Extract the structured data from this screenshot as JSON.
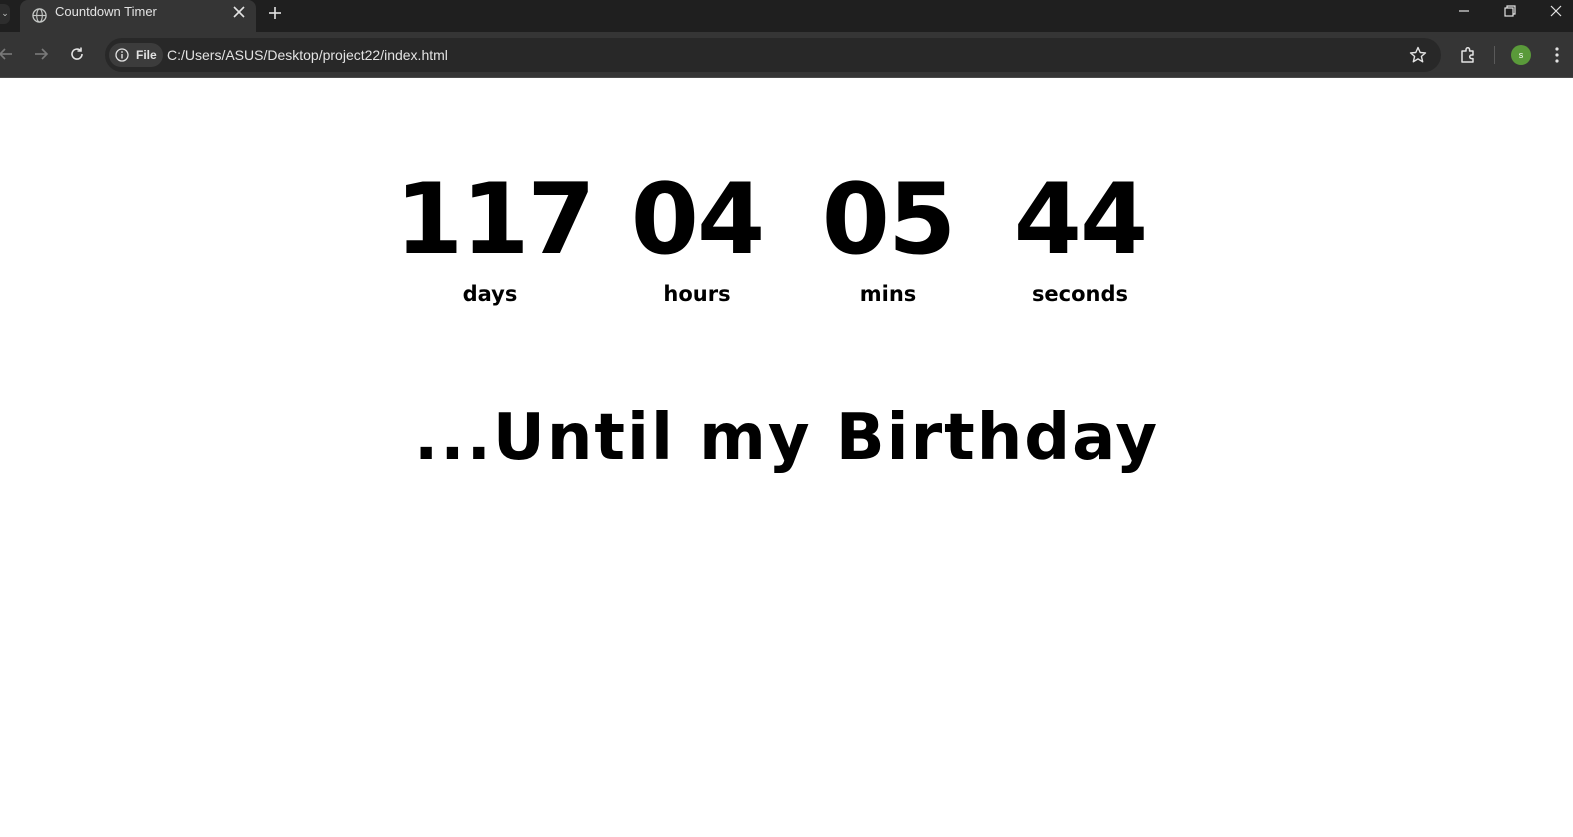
{
  "browser": {
    "tab_title": "Countdown Timer",
    "site_chip": "File",
    "url": "C:/Users/ASUS/Desktop/project22/index.html",
    "profile_initial": "s"
  },
  "countdown": {
    "days": {
      "value": "117",
      "label": "days"
    },
    "hours": {
      "value": "04",
      "label": "hours"
    },
    "mins": {
      "value": "05",
      "label": "mins"
    },
    "seconds": {
      "value": "44",
      "label": "seconds"
    }
  },
  "subtitle": "...Until my Birthday",
  "colors": {
    "chrome_dark": "#1f1f1f",
    "chrome_toolbar": "#353535",
    "page_bg": "#ffffff",
    "text": "#000000",
    "avatar": "#5a9a3a"
  }
}
